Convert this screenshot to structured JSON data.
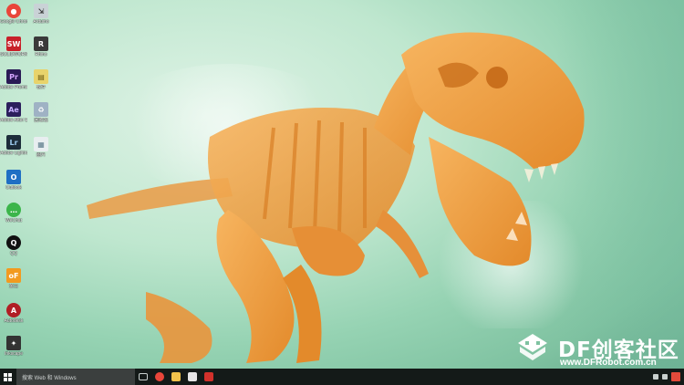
{
  "desktop": {
    "icons": [
      {
        "label": "Google Chrome",
        "icon": "chrome-icon",
        "color": "#e9463a"
      },
      {
        "label": "SOLIDWORKS",
        "icon": "solidworks-icon",
        "color": "#c8202a"
      },
      {
        "label": "Adobe Premiere",
        "icon": "premiere-icon",
        "color": "#2a1a55"
      },
      {
        "label": "Adobe After Effects",
        "icon": "after-effects-icon",
        "color": "#2b1f5c"
      },
      {
        "label": "Adobe Lightroom",
        "icon": "lightroom-icon",
        "color": "#1d2d3a"
      },
      {
        "label": "Outlook",
        "icon": "outlook-icon",
        "color": "#1f6fc4"
      },
      {
        "label": "WeChat",
        "icon": "wechat-icon",
        "color": "#3bb54a"
      },
      {
        "label": "QQ",
        "icon": "qq-icon",
        "color": "#111111"
      },
      {
        "label": "金山",
        "icon": "app-icon",
        "color": "#f29a1f"
      },
      {
        "label": "Autodesk",
        "icon": "autodesk-icon",
        "color": "#b01e24"
      },
      {
        "label": "Inkscape",
        "icon": "inkscape-icon",
        "color": "#333333"
      },
      {
        "label": "Arduino",
        "icon": "shortcut-icon",
        "color": "#c9d2d6"
      },
      {
        "label": "Rhino",
        "icon": "rhino-icon",
        "color": "#3a3a3a"
      },
      {
        "label": "软件",
        "icon": "folder-icon",
        "color": "#e8d36b"
      },
      {
        "label": "回收站",
        "icon": "recycle-bin-icon",
        "color": "#9fb2c4"
      },
      {
        "label": "图片",
        "icon": "image-icon",
        "color": "#e8eef0"
      }
    ]
  },
  "watermark": {
    "title": "DF创客社区",
    "url": "www.DFRobot.com.cn"
  },
  "taskbar": {
    "search_placeholder": "搜索 Web 和 Windows",
    "apps": [
      {
        "name": "task-view",
        "color": "#c9d0ce"
      },
      {
        "name": "chrome",
        "color": "#e9463a"
      },
      {
        "name": "file-explorer",
        "color": "#f0c24b"
      },
      {
        "name": "photos",
        "color": "#e6e6e6"
      },
      {
        "name": "app",
        "color": "#d2312b"
      }
    ]
  }
}
